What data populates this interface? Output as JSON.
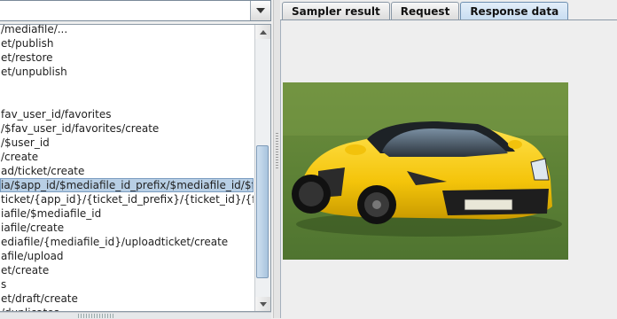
{
  "sampler_tree": {
    "selector_value": "",
    "items": [
      "/mediafile/...",
      "et/publish",
      "et/restore",
      "et/unpublish",
      "",
      "",
      "fav_user_id/favorites",
      "/$fav_user_id/favorites/create",
      "/$user_id",
      "/create",
      "ad/ticket/create",
      "ia/$app_id/$mediafile_id_prefix/$mediafile_id/$filename",
      "ticket/{app_id}/{ticket_id_prefix}/{ticket_id}/{filename}",
      "iafile/$mediafile_id",
      "iafile/create",
      "ediafile/{mediafile_id}/uploadticket/create",
      "afile/upload",
      "et/create",
      "s",
      "et/draft/create",
      "/duplicates"
    ],
    "selected_index": 11
  },
  "results": {
    "tabs": [
      {
        "label": "Sampler result",
        "active": false
      },
      {
        "label": "Request",
        "active": false
      },
      {
        "label": "Response data",
        "active": true
      }
    ],
    "image": {
      "subject": "yellow convertible sports car on grass"
    }
  }
}
